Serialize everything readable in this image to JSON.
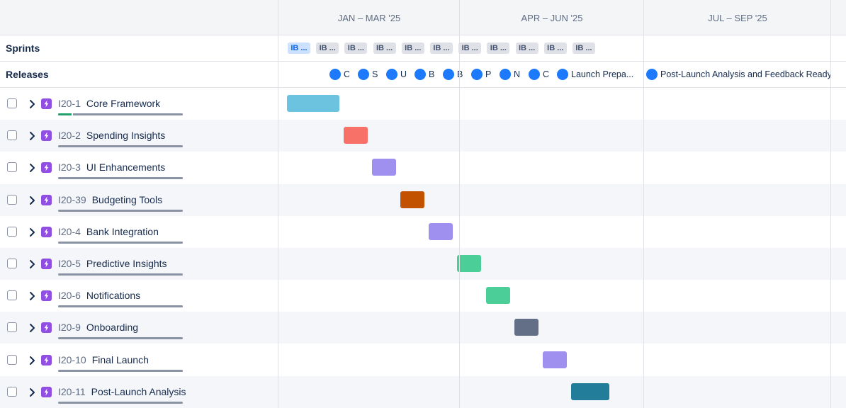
{
  "timeline": {
    "quarters": [
      "JAN – MAR '25",
      "APR – JUN '25",
      "JUL – SEP '25"
    ],
    "sprints_label": "Sprints",
    "releases_label": "Releases",
    "sprints": [
      {
        "label": "IB ...",
        "active": true
      },
      {
        "label": "IB ...",
        "active": false
      },
      {
        "label": "IB ...",
        "active": false
      },
      {
        "label": "IB ...",
        "active": false
      },
      {
        "label": "IB ...",
        "active": false
      },
      {
        "label": "IB ...",
        "active": false
      },
      {
        "label": "IB ...",
        "active": false
      },
      {
        "label": "IB ...",
        "active": false
      },
      {
        "label": "IB ...",
        "active": false
      },
      {
        "label": "IB ...",
        "active": false
      },
      {
        "label": "IB ...",
        "active": false
      }
    ],
    "releases": [
      {
        "label": "C"
      },
      {
        "label": "S"
      },
      {
        "label": "U"
      },
      {
        "label": "B"
      },
      {
        "label": "B"
      },
      {
        "label": "P"
      },
      {
        "label": "N"
      },
      {
        "label": "C"
      },
      {
        "label": "Launch Prepa..."
      },
      {
        "label": "Post-Launch Analysis and Feedback Ready"
      }
    ],
    "issues": [
      {
        "key": "I20-1",
        "title": "Core Framework",
        "progress": 0.12,
        "bar_color": "#6cc3e0"
      },
      {
        "key": "I20-2",
        "title": "Spending Insights",
        "progress": 0,
        "bar_color": "#f87168"
      },
      {
        "key": "I20-3",
        "title": "UI Enhancements",
        "progress": 0,
        "bar_color": "#9f8fef"
      },
      {
        "key": "I20-39",
        "title": "Budgeting Tools",
        "progress": 0,
        "bar_color": "#c25100"
      },
      {
        "key": "I20-4",
        "title": "Bank Integration",
        "progress": 0,
        "bar_color": "#9f8fef"
      },
      {
        "key": "I20-5",
        "title": "Predictive Insights",
        "progress": 0,
        "bar_color": "#4bce97"
      },
      {
        "key": "I20-6",
        "title": "Notifications",
        "progress": 0,
        "bar_color": "#4bce97"
      },
      {
        "key": "I20-9",
        "title": "Onboarding",
        "progress": 0,
        "bar_color": "#626f86"
      },
      {
        "key": "I20-10",
        "title": "Final Launch",
        "progress": 0,
        "bar_color": "#9f8fef"
      },
      {
        "key": "I20-11",
        "title": "Post-Launch Analysis",
        "progress": 0,
        "bar_color": "#227d9b"
      }
    ]
  }
}
